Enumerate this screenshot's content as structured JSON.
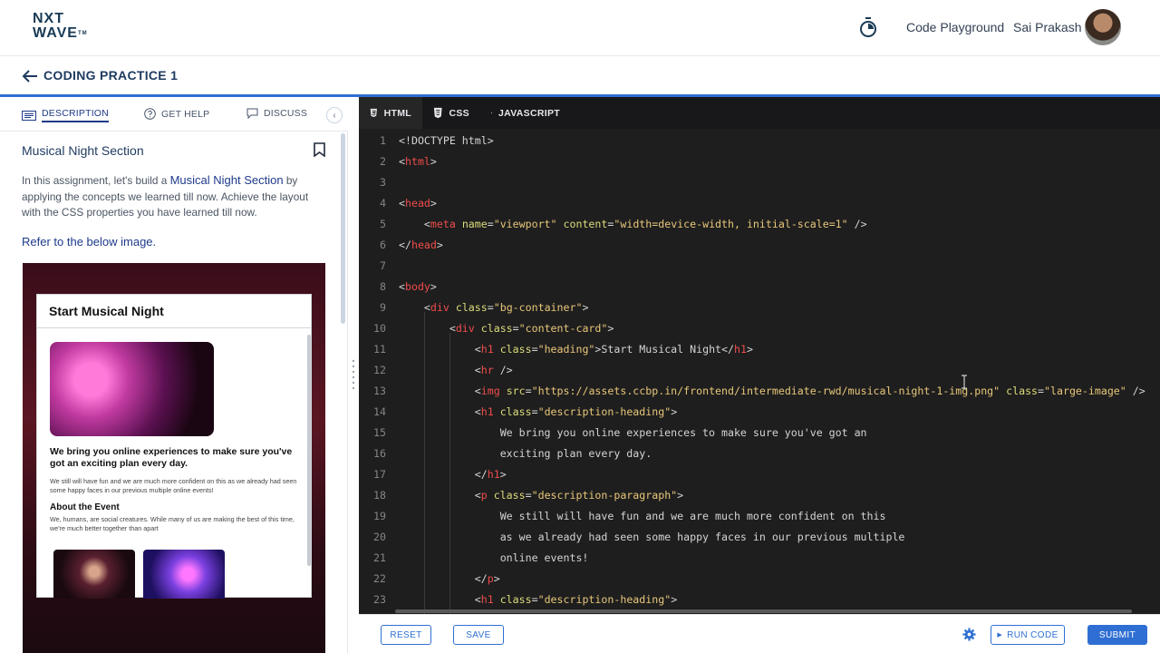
{
  "topnav": {
    "logo_line1": "NXT",
    "logo_line2": "WAVE",
    "logo_tm": "TM",
    "playground_label": "Code Playground",
    "user_name": "Sai Prakash"
  },
  "subheader": {
    "title": "CODING PRACTICE 1"
  },
  "left_tabs": [
    {
      "label": "DESCRIPTION"
    },
    {
      "label": "GET HELP"
    },
    {
      "label": "DISCUSS"
    }
  ],
  "question": {
    "title": "Musical Night Section",
    "desc_prefix": "In this assignment, let's build a",
    "desc_highlight": "Musical Night Section",
    "desc_suffix": "by applying the concepts we learned till now. Achieve the layout with the CSS properties you have learned till now.",
    "refer_text": "Refer to the below image."
  },
  "preview": {
    "heading": "Start Musical Night",
    "desc_heading": "We bring you online experiences to make sure you've got an exciting plan every day.",
    "desc_paragraph": "We still will have fun and we are much more confident on this as we already had seen some happy faces in our previous multiple online events!",
    "about_heading": "About the Event",
    "about_paragraph": "We, humans, are social creatures. While many of us are making the best of this time, we're much better together than apart"
  },
  "editor_tabs": [
    {
      "label": "HTML",
      "icon": "html5-icon"
    },
    {
      "label": "CSS",
      "icon": "css3-icon"
    },
    {
      "label": "JAVASCRIPT",
      "icon": "js-file-icon"
    }
  ],
  "code_lines": [
    {
      "n": "1"
    },
    {
      "n": "2"
    },
    {
      "n": "3"
    },
    {
      "n": "4"
    },
    {
      "n": "5"
    },
    {
      "n": "6"
    },
    {
      "n": "7"
    },
    {
      "n": "8"
    },
    {
      "n": "9"
    },
    {
      "n": "10"
    },
    {
      "n": "11"
    },
    {
      "n": "12"
    },
    {
      "n": "13"
    },
    {
      "n": "14"
    },
    {
      "n": "15"
    },
    {
      "n": "16"
    },
    {
      "n": "17"
    },
    {
      "n": "18"
    },
    {
      "n": "19"
    },
    {
      "n": "20"
    },
    {
      "n": "21"
    },
    {
      "n": "22"
    },
    {
      "n": "23"
    }
  ],
  "code_text": {
    "l1": "<!DOCTYPE html>",
    "l13_src": "\"https://assets.ccbp.in/frontend/intermediate-rwd/musical-night-1-img.png\"",
    "l15": "We bring you online experiences to make sure you've got an",
    "l16": "exciting plan every day.",
    "l19": "We still will have fun and we are much more confident on this",
    "l20": "as we already had seen some happy faces in our previous multiple",
    "l21": "online events!",
    "l11_text": "Start Musical Night"
  },
  "bottom": {
    "reset": "RESET",
    "save": "SAVE",
    "run_code": "RUN CODE",
    "submit": "SUBMIT"
  },
  "colors": {
    "accent": "#2f6fd3",
    "brand_text": "#183b56",
    "editor_bg": "#1e1e1e"
  }
}
